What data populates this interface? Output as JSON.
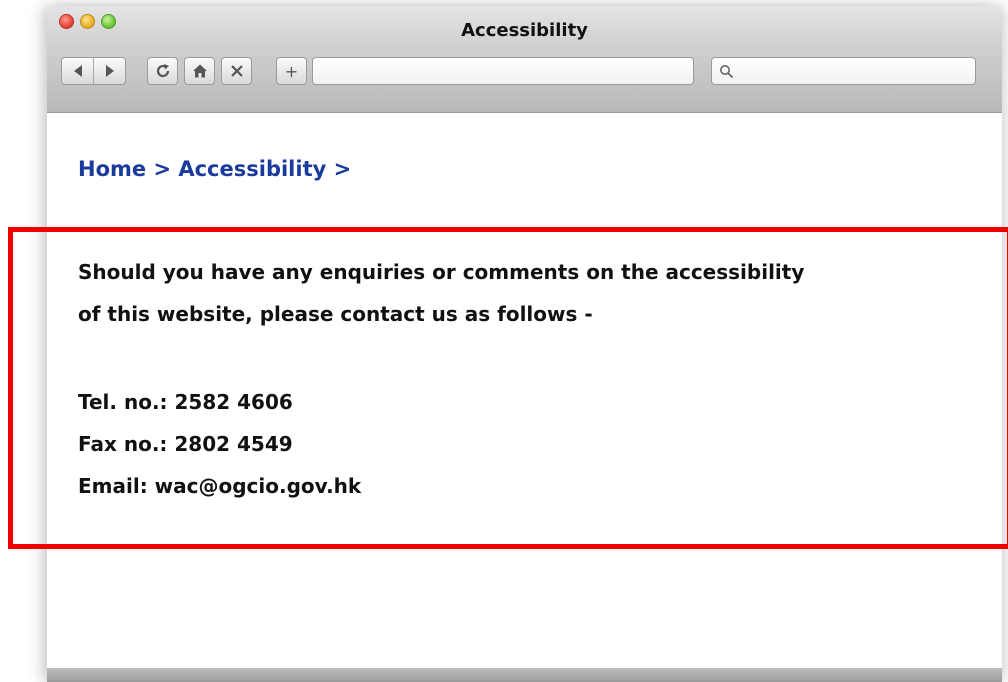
{
  "window": {
    "title": "Accessibility",
    "colors": {
      "highlight": "#ee0000",
      "link": "#1a3a9c"
    }
  },
  "toolbar": {
    "back_icon": "back-arrow-icon",
    "forward_icon": "forward-arrow-icon",
    "reload_icon": "reload-icon",
    "home_icon": "home-icon",
    "stop_icon": "close-icon",
    "new_tab_label": "+",
    "search_icon": "search-icon"
  },
  "breadcrumb": {
    "home": "Home",
    "separator1": " > ",
    "accessibility": "Accessibility",
    "separator2": " >"
  },
  "message": {
    "line1": "Should you have any enquiries or comments on the accessibility",
    "line2": "of this website, please contact us as follows -"
  },
  "contact": {
    "tel": "Tel. no.: 2582 4606",
    "fax": "Fax no.: 2802 4549",
    "email": "Email: wac@ogcio.gov.hk"
  }
}
